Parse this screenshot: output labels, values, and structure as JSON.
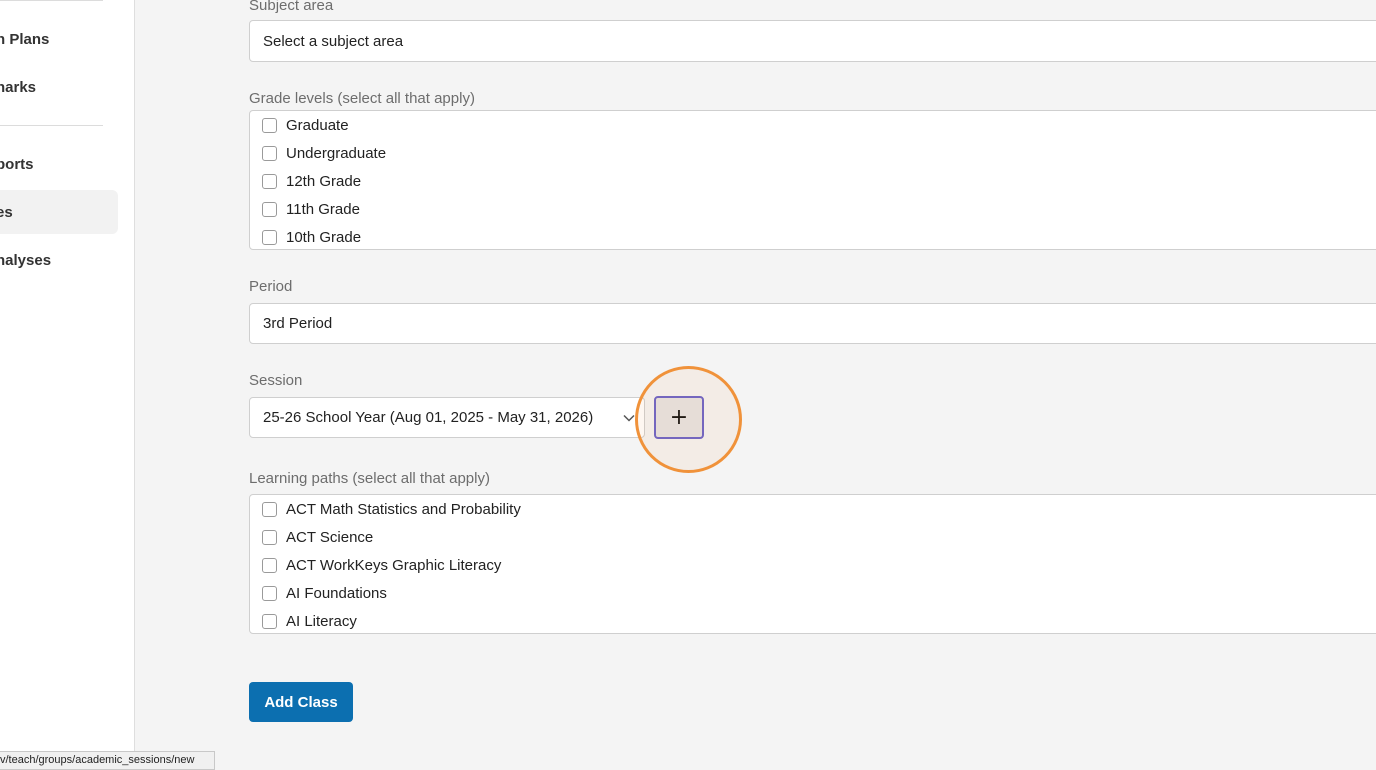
{
  "sidebar": {
    "items": [
      {
        "label": "n Plans"
      },
      {
        "label": "narks"
      },
      {
        "label": "ports"
      },
      {
        "label": "es"
      },
      {
        "label": "nalyses"
      }
    ]
  },
  "form": {
    "subject_area": {
      "label": "Subject area",
      "value": "Select a subject area"
    },
    "grade_levels": {
      "label": "Grade levels (select all that apply)",
      "options": [
        "Graduate",
        "Undergraduate",
        "12th Grade",
        "11th Grade",
        "10th Grade"
      ]
    },
    "period": {
      "label": "Period",
      "value": "3rd Period"
    },
    "session": {
      "label": "Session",
      "value": "25-26 School Year (Aug 01, 2025 - May 31, 2026)",
      "add_label": "+"
    },
    "learning_paths": {
      "label": "Learning paths (select all that apply)",
      "options": [
        "ACT Math Statistics and Probability",
        "ACT Science",
        "ACT WorkKeys Graphic Literacy",
        "AI Foundations",
        "AI Literacy"
      ]
    },
    "submit_label": "Add Class"
  },
  "status_bar": {
    "url": "v/teach/groups/academic_sessions/new"
  },
  "colors": {
    "primary": "#0c6fb0",
    "highlight": "#f0923a",
    "focus": "#6b63c9"
  }
}
